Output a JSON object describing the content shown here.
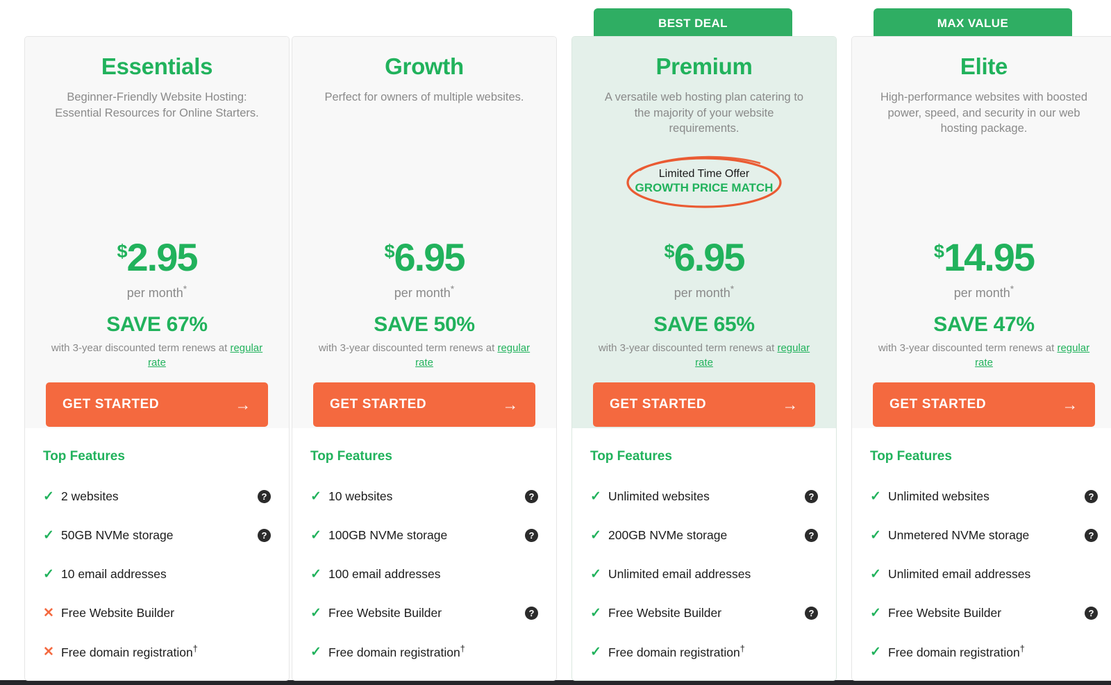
{
  "theme": {
    "green": "#21b25c",
    "ribbon_green": "#2FAE63",
    "orange": "#f4693f",
    "featured_bg": "#e4f0ea",
    "card_bg": "#f8f8f8",
    "muted_text": "#8a8a8a"
  },
  "features_heading": "Top Features",
  "cta_label": "GET STARTED",
  "cta_arrow": "→",
  "check_glyph": "✓",
  "cross_glyph": "✕",
  "help_glyph": "?",
  "plans": [
    {
      "ribbon": "",
      "name": "Essentials",
      "description": "Beginner-Friendly Website Hosting: Essential Resources for Online Starters.",
      "promo": null,
      "currency": "$",
      "price": "2.95",
      "per_month": "per month",
      "per_month_asterisk": "*",
      "save": "SAVE 67%",
      "renew_prefix": "with 3-year discounted term renews at ",
      "renew_link": "regular rate",
      "features": [
        {
          "label": "2 websites",
          "included": true,
          "help": true
        },
        {
          "label": "50GB NVMe storage",
          "included": true,
          "help": true
        },
        {
          "label": "10 email addresses",
          "included": true,
          "help": false
        },
        {
          "label": "Free Website Builder",
          "included": false,
          "help": false
        },
        {
          "label": "Free domain registration",
          "dagger": "†",
          "included": false,
          "help": false
        }
      ]
    },
    {
      "ribbon": "",
      "name": "Growth",
      "description": "Perfect for owners of multiple websites.",
      "promo": null,
      "currency": "$",
      "price": "6.95",
      "per_month": "per month",
      "per_month_asterisk": "*",
      "save": "SAVE 50%",
      "renew_prefix": "with 3-year discounted term renews at ",
      "renew_link": "regular rate",
      "features": [
        {
          "label": "10 websites",
          "included": true,
          "help": true
        },
        {
          "label": "100GB NVMe storage",
          "included": true,
          "help": true
        },
        {
          "label": "100 email addresses",
          "included": true,
          "help": false
        },
        {
          "label": "Free Website Builder",
          "included": true,
          "help": true
        },
        {
          "label": "Free domain registration",
          "dagger": "†",
          "included": true,
          "help": false
        }
      ]
    },
    {
      "ribbon": "BEST DEAL",
      "name": "Premium",
      "description": "A versatile web hosting plan catering to the majority of your website requirements.",
      "promo": {
        "line1": "Limited Time Offer",
        "line2": "GROWTH PRICE MATCH"
      },
      "currency": "$",
      "price": "6.95",
      "per_month": "per month",
      "per_month_asterisk": "*",
      "save": "SAVE 65%",
      "renew_prefix": "with 3-year discounted term renews at ",
      "renew_link": "regular rate",
      "features": [
        {
          "label": "Unlimited websites",
          "included": true,
          "help": true
        },
        {
          "label": "200GB NVMe storage",
          "included": true,
          "help": true
        },
        {
          "label": "Unlimited email addresses",
          "included": true,
          "help": false
        },
        {
          "label": "Free Website Builder",
          "included": true,
          "help": true
        },
        {
          "label": "Free domain registration",
          "dagger": "†",
          "included": true,
          "help": false
        }
      ]
    },
    {
      "ribbon": "MAX VALUE",
      "name": "Elite",
      "description": "High-performance websites with boosted power, speed, and security in our web hosting package.",
      "promo": null,
      "currency": "$",
      "price": "14.95",
      "per_month": "per month",
      "per_month_asterisk": "*",
      "save": "SAVE 47%",
      "renew_prefix": "with 3-year discounted term renews at ",
      "renew_link": "regular rate",
      "features": [
        {
          "label": "Unlimited websites",
          "included": true,
          "help": true
        },
        {
          "label": "Unmetered NVMe storage",
          "included": true,
          "help": true
        },
        {
          "label": "Unlimited email addresses",
          "included": true,
          "help": false
        },
        {
          "label": "Free Website Builder",
          "included": true,
          "help": true
        },
        {
          "label": "Free domain registration",
          "dagger": "†",
          "included": true,
          "help": false
        }
      ]
    }
  ]
}
